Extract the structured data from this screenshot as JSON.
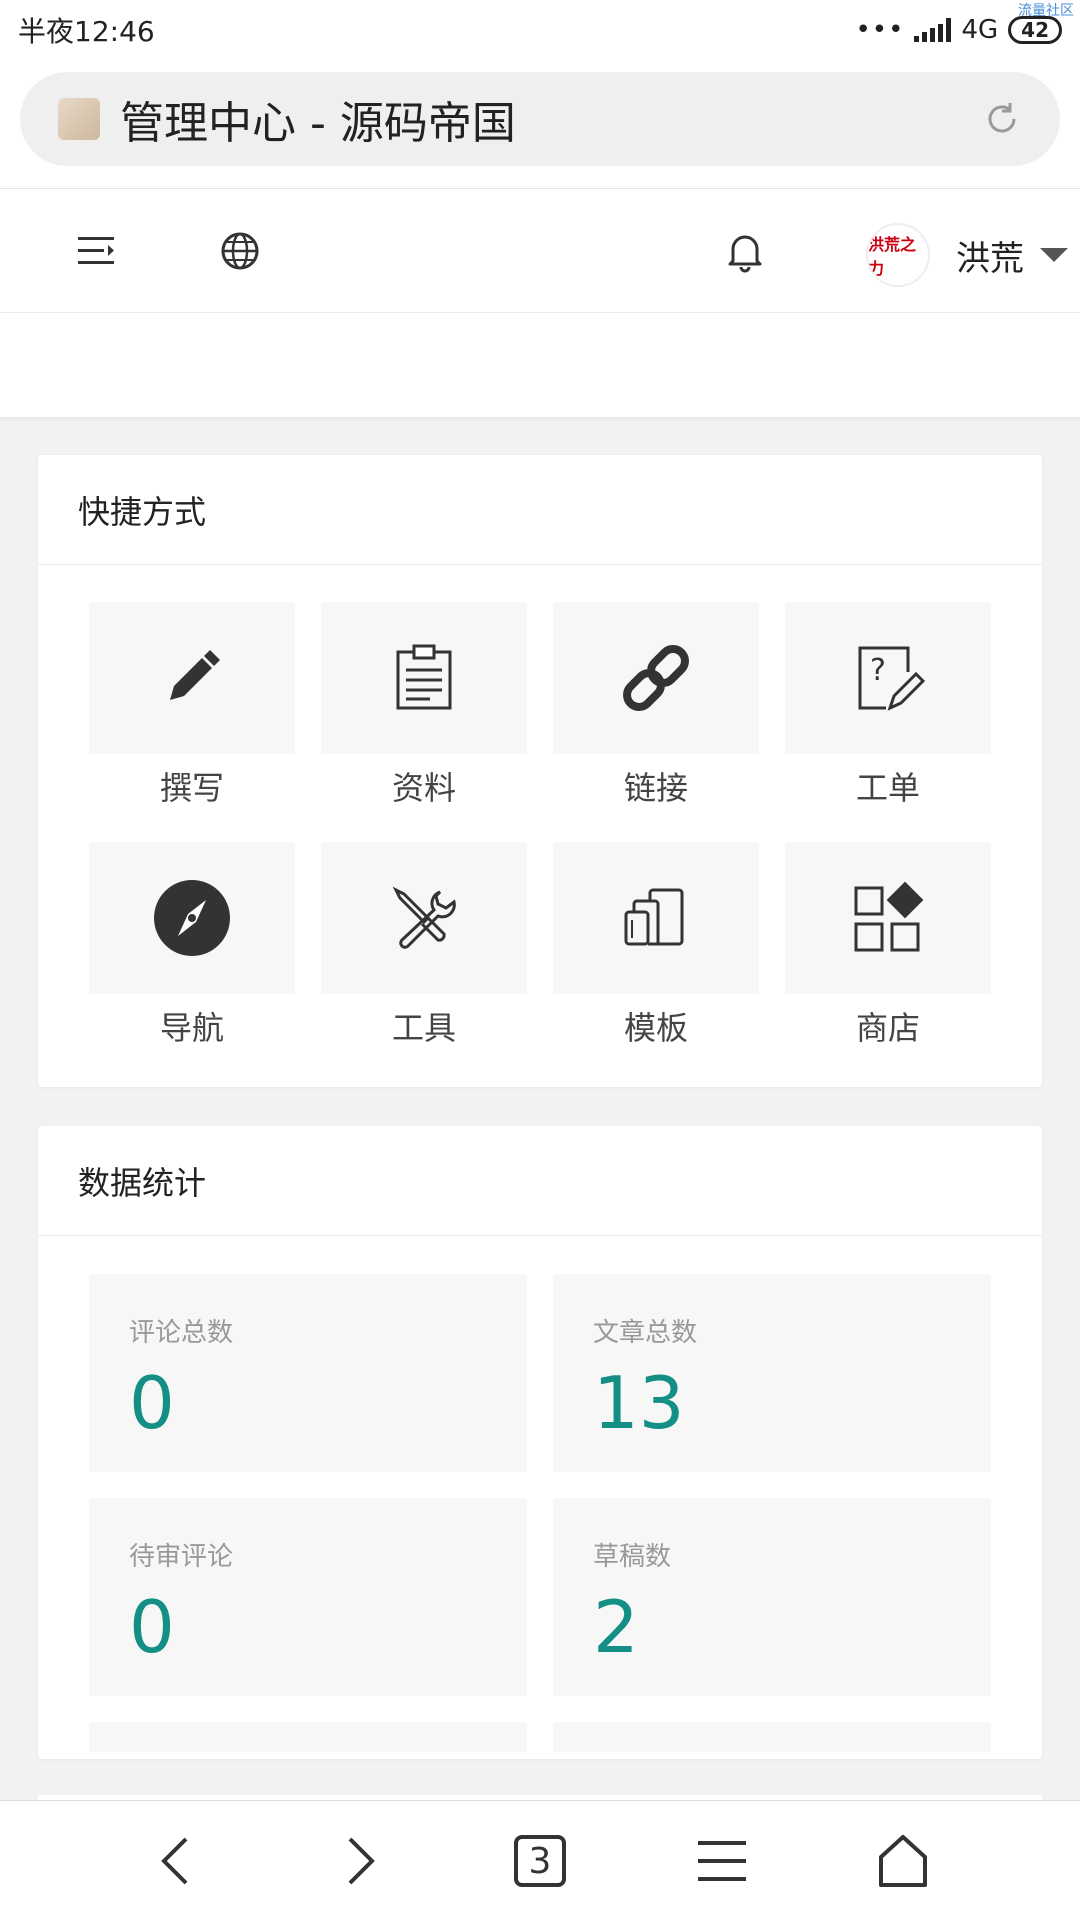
{
  "status": {
    "time": "半夜12:46",
    "network": "4G",
    "battery": "42",
    "dots": "•••",
    "watermark": "流量社区"
  },
  "browser": {
    "title": "管理中心 - 源码帝国",
    "tab_count": "3"
  },
  "header": {
    "username": "洪荒",
    "avatar_text": "洪荒之力"
  },
  "shortcuts": {
    "title": "快捷方式",
    "items": [
      {
        "label": "撰写",
        "icon": "pencil-icon"
      },
      {
        "label": "资料",
        "icon": "clipboard-icon"
      },
      {
        "label": "链接",
        "icon": "link-icon"
      },
      {
        "label": "工单",
        "icon": "ticket-icon"
      },
      {
        "label": "导航",
        "icon": "compass-icon"
      },
      {
        "label": "工具",
        "icon": "tools-icon"
      },
      {
        "label": "模板",
        "icon": "template-icon"
      },
      {
        "label": "商店",
        "icon": "store-icon"
      }
    ]
  },
  "stats": {
    "title": "数据统计",
    "items": [
      {
        "label": "评论总数",
        "value": "0"
      },
      {
        "label": "文章总数",
        "value": "13"
      },
      {
        "label": "待审评论",
        "value": "0"
      },
      {
        "label": "草稿数",
        "value": "2"
      }
    ]
  },
  "colors": {
    "accent": "#138f85",
    "tile_bg": "#f7f7f7",
    "page_bg": "#f2f2f2"
  }
}
